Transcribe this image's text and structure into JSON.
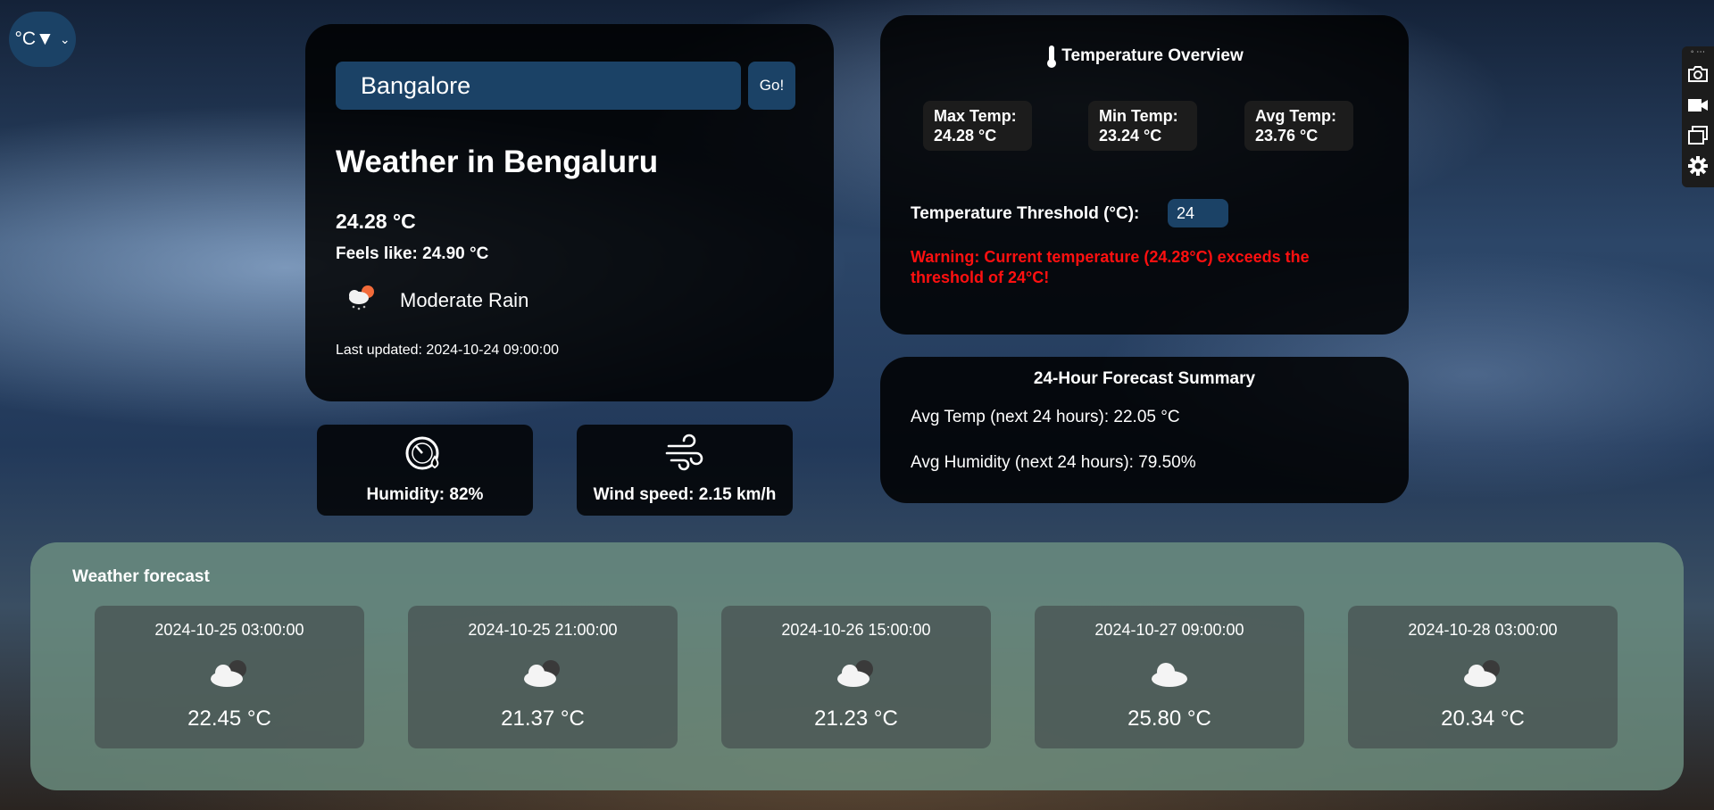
{
  "unit_select": {
    "value": "°C▼"
  },
  "search": {
    "value": "Bangalore",
    "go_label": "Go!"
  },
  "current": {
    "title": "Weather in Bengaluru",
    "temp": "24.28 °C",
    "feels_like": "Feels like: 24.90 °C",
    "condition": "Moderate Rain",
    "condition_icon": "rain-cloud-sun-icon",
    "last_updated": "Last updated: 2024-10-24 09:00:00"
  },
  "humidity": {
    "label": "Humidity: 82%",
    "icon": "humidity-gauge-icon"
  },
  "wind": {
    "label": "Wind speed: 2.15 km/h",
    "icon": "wind-icon"
  },
  "overview": {
    "title": "Temperature Overview",
    "icon": "thermometer-icon",
    "max_label": "Max Temp:",
    "max_value": "24.28 °C",
    "min_label": "Min Temp:",
    "min_value": "23.24 °C",
    "avg_label": "Avg Temp:",
    "avg_value": "23.76 °C",
    "threshold_label": "Temperature Threshold (°C):",
    "threshold_value": "24",
    "warning": "Warning: Current temperature (24.28°C) exceeds the threshold of 24°C!",
    "warning_color": "#ff1010"
  },
  "summary": {
    "title": "24-Hour Forecast Summary",
    "avg_temp": "Avg Temp (next 24 hours): 22.05 °C",
    "avg_humidity": "Avg Humidity (next 24 hours): 79.50%"
  },
  "forecast": {
    "title": "Weather forecast",
    "items": [
      {
        "date": "2024-10-25 03:00:00",
        "temp": "22.45 °C",
        "icon": "cloud-night-icon"
      },
      {
        "date": "2024-10-25 21:00:00",
        "temp": "21.37 °C",
        "icon": "cloud-night-icon"
      },
      {
        "date": "2024-10-26 15:00:00",
        "temp": "21.23 °C",
        "icon": "cloud-night-icon"
      },
      {
        "date": "2024-10-27 09:00:00",
        "temp": "25.80 °C",
        "icon": "cloud-icon"
      },
      {
        "date": "2024-10-28 03:00:00",
        "temp": "20.34 °C",
        "icon": "cloud-night-icon"
      }
    ]
  },
  "toolbar": {
    "items": [
      "camera-icon",
      "video-icon",
      "windows-icon",
      "settings-icon"
    ]
  },
  "colors": {
    "accent": "#1b4266",
    "panel": "#000000",
    "forecast_bg": "#6e9182"
  }
}
